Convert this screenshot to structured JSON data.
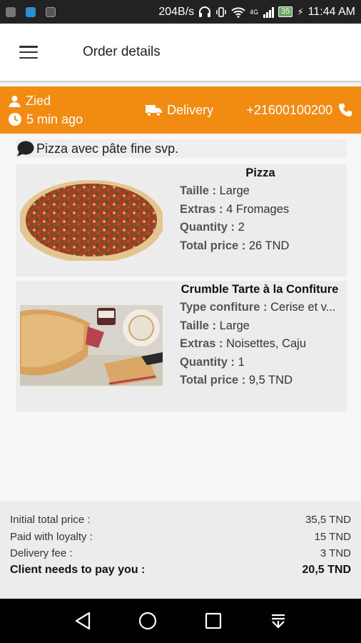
{
  "status_bar": {
    "network_speed": "204B/s",
    "battery": "35",
    "network_type": "4G",
    "time": "11:44 AM"
  },
  "app_bar": {
    "title": "Order details"
  },
  "order_info": {
    "customer_name": "Zied",
    "time_ago": "5 min ago",
    "delivery_label": "Delivery",
    "phone": "+21600100200",
    "accent_color": "#f18b12"
  },
  "note": {
    "text": "Pizza avec pâte fine svp."
  },
  "items": [
    {
      "name": "Pizza",
      "image": "pizza-photo",
      "lines": [
        {
          "label": "Taille :",
          "value": " Large"
        },
        {
          "label": "Extras :",
          "value": " 4 Fromages"
        },
        {
          "label": "Quantity :",
          "value": " 2"
        },
        {
          "label": "Total price :",
          "value": " 26 TND"
        }
      ]
    },
    {
      "name": "Crumble Tarte à la Confiture",
      "image": "crumble-tart-photo",
      "lines": [
        {
          "label": "Type confiture :",
          "value": " Cerise et v..."
        },
        {
          "label": "Taille :",
          "value": " Large"
        },
        {
          "label": "Extras :",
          "value": " Noisettes, Caju"
        },
        {
          "label": "Quantity :",
          "value": " 1"
        },
        {
          "label": "Total price :",
          "value": " 9,5 TND"
        }
      ]
    }
  ],
  "summary": {
    "initial_total_label": "Initial total price :",
    "initial_total_value": "35,5 TND",
    "loyalty_label": "Paid with loyalty :",
    "loyalty_value": "15 TND",
    "delivery_fee_label": "Delivery fee :",
    "delivery_fee_value": "3 TND",
    "client_pay_label": "Client needs to pay you :",
    "client_pay_value": "20,5 TND"
  },
  "nav_bar": {
    "buttons": [
      "back-icon",
      "home-icon",
      "recents-icon",
      "notifications-icon"
    ]
  }
}
